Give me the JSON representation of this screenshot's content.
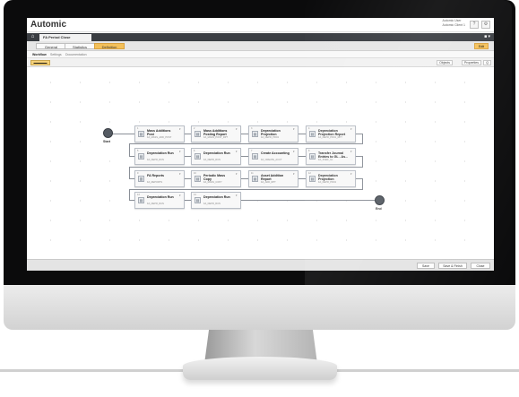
{
  "app": {
    "logo": "Automic",
    "user_line1": "Automic User",
    "user_line2": "Automic Client 1"
  },
  "header_icons": {
    "help": "?",
    "settings": "⚙"
  },
  "document_tab": {
    "label": "FA Period Close"
  },
  "tab_extra": "■ ▾",
  "section_tabs": [
    "General",
    "Statistics",
    "Definition"
  ],
  "save_chip": "Edit",
  "sub_tabs": [
    "Workflow",
    "Settings",
    "Documentation"
  ],
  "tool_row": {
    "zoom": "▬▬▬▬▬",
    "objects": "Objects",
    "properties": "Properties",
    "search": "Q"
  },
  "workflow": {
    "start_label": "Start",
    "end_label": "End",
    "nodes": [
      {
        "num": "1",
        "title": "Mass Additions Post",
        "sub": "FA_MASS_ADD_POST",
        "state": ""
      },
      {
        "num": "2",
        "title": "Mass Additions Posting Report",
        "sub": "FA_MASS_POST_RPT",
        "state": ""
      },
      {
        "num": "3",
        "title": "Depreciation Projection",
        "sub": "FA_DEPR_PROJ",
        "state": ""
      },
      {
        "num": "4",
        "title": "Depreciation Projection Report",
        "sub": "FA_DEPR_PROJ_RPT",
        "state": ""
      },
      {
        "num": "5",
        "title": "Depreciation Run",
        "sub": "FA_DEPR_RUN",
        "state": ""
      },
      {
        "num": "6",
        "title": "Depreciation Run",
        "sub": "FA_DEPR_RUN",
        "state": ""
      },
      {
        "num": "7",
        "title": "Create Accounting",
        "sub": "FA_CREATE_ACCT",
        "state": ""
      },
      {
        "num": "8",
        "title": "Transfer Journal Entries to GL - As...",
        "sub": "FA_XFER_GL",
        "state": ""
      },
      {
        "num": "9",
        "title": "FA Reports",
        "sub": "FA_REPORTS",
        "state": ""
      },
      {
        "num": "10",
        "title": "Periodic Mass Copy",
        "sub": "FA_MASS_COPY",
        "state": ""
      },
      {
        "num": "11",
        "title": "Asset Addition Report",
        "sub": "FA_ADD_RPT",
        "state": ""
      },
      {
        "num": "12",
        "title": "Depreciation Projection",
        "sub": "FA_DEPR_PROJ",
        "state": ""
      },
      {
        "num": "13",
        "title": "Depreciation Run",
        "sub": "FA_DEPR_RUN",
        "state": ""
      },
      {
        "num": "14",
        "title": "Depreciation Run",
        "sub": "FA_DEPR_RUN",
        "state": ""
      }
    ]
  },
  "footer": {
    "save": "Save",
    "save_close": "Save & Finish",
    "close": "Close"
  }
}
